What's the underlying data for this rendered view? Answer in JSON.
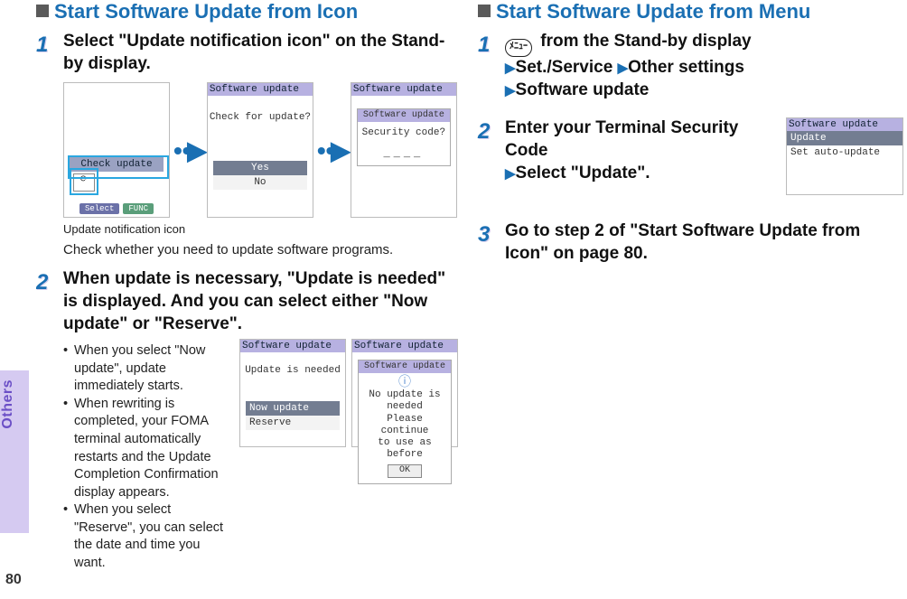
{
  "spine": {
    "tab_label": "Others",
    "page_number": "80"
  },
  "left": {
    "heading": "Start Software Update from Icon",
    "step1": {
      "num": "1",
      "title": "Select \"Update notification icon\" on the Stand-by display.",
      "shot1": {
        "titlebar": "",
        "menu_hi": "Check update",
        "btn_select": "Select",
        "btn_func": "FUNC"
      },
      "shot2": {
        "titlebar": "Software update",
        "prompt": "Check for update?",
        "opt_yes": "Yes",
        "opt_no": "No"
      },
      "shot3": {
        "titlebar": "Software update",
        "sub_titlebar": "Software update",
        "prompt": "Security code?",
        "blanks": "____"
      },
      "caption_icon": "Update notification icon",
      "caption_check": "Check whether you need to update software programs."
    },
    "step2": {
      "num": "2",
      "title": "When update is necessary, \"Update is needed\" is displayed. And you can select either \"Now update\" or \"Reserve\".",
      "bullet1": "When you select \"Now update\", update immediately starts.",
      "bullet2": "When rewriting is completed, your FOMA terminal automatically restarts and the Update Completion Confirmation display appears.",
      "bullet3": "When you select \"Reserve\", you can select the date and time you want.",
      "shotA": {
        "titlebar": "Software update",
        "msg": "Update is needed",
        "opt_now": "Now update",
        "opt_reserve": "Reserve"
      },
      "shotB": {
        "titlebar": "Software update",
        "sub_titlebar": "Software update",
        "msg_l1": "No update is",
        "msg_l2": "needed",
        "msg_l3": "Please continue",
        "msg_l4": "to use as before",
        "ok": "OK"
      }
    }
  },
  "right": {
    "heading": "Start Software Update from Menu",
    "step1": {
      "num": "1",
      "menu_glyph": "ﾒﾆｭｰ",
      "line1_rest": " from the Stand-by display",
      "line2_a": "Set./Service",
      "line2_b": "Other settings",
      "line3": "Software update"
    },
    "step2": {
      "num": "2",
      "line1": "Enter your Terminal Security Code",
      "line2": "Select \"Update\".",
      "shot": {
        "titlebar": "Software update",
        "row_hi": "Update",
        "row_plain": "Set auto-update"
      }
    },
    "step3": {
      "num": "3",
      "text": "Go to step 2 of \"Start Software Update from Icon\" on page 80."
    }
  }
}
